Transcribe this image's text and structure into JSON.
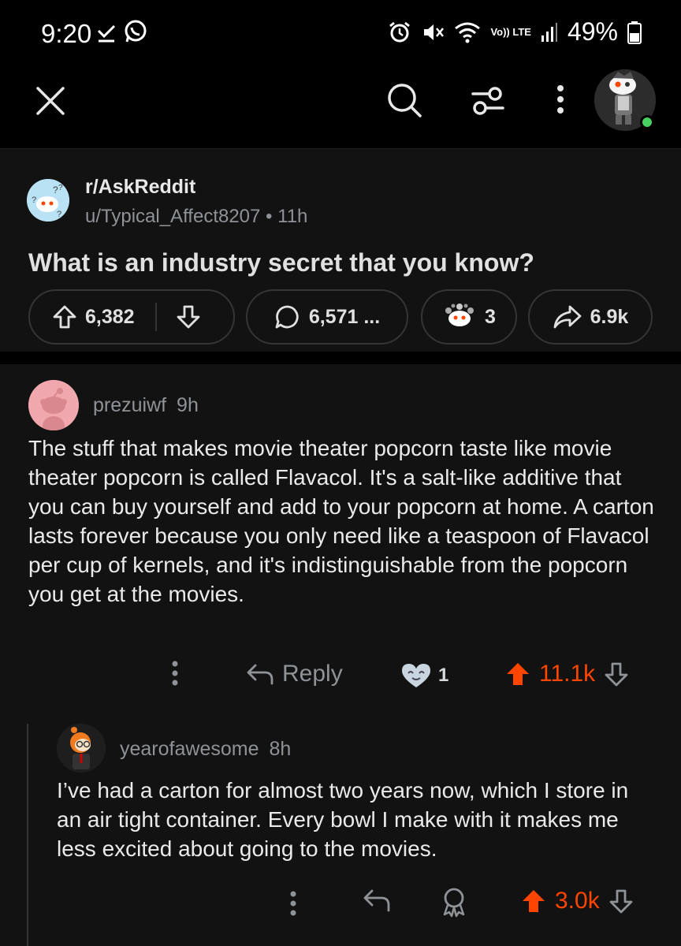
{
  "status_bar": {
    "time": "9:20",
    "battery": "49%",
    "network": "Vo)) LTE"
  },
  "nav": {
    "close_icon": "close-icon",
    "search_icon": "search-icon",
    "filter_icon": "filter-icon",
    "more_icon": "more-vertical-icon"
  },
  "post": {
    "subreddit": "r/AskReddit",
    "author": "u/Typical_Affect8207",
    "separator": "•",
    "age": "11h",
    "title": "What is an industry secret that you know?",
    "upvotes": "6,382",
    "comments": "6,571 ...",
    "awards": "3",
    "shares": "6.9k"
  },
  "comments": [
    {
      "author": "prezuiwf",
      "age": "9h",
      "body": "The stuff that makes movie theater popcorn taste like movie theater popcorn is called Flavacol. It's a salt-like additive that you can buy yourself and add to your popcorn at home. A carton lasts forever because you only need like a teaspoon of Flavacol per cup of kernels, and it's indistinguishable from the popcorn you get at the movies.",
      "reply_label": "Reply",
      "award_count": "1",
      "score": "11.1k"
    },
    {
      "author": "yearofawesome",
      "age": "8h",
      "body": "I’ve had a carton for almost two years now, which I store in an air tight container.  Every bowl I make with it makes me less excited about going to the movies.",
      "score": "3.0k"
    }
  ],
  "colors": {
    "background": "#000000",
    "card": "#121212",
    "upvote": "#ff4500",
    "muted": "#8f9296",
    "online": "#46d160"
  }
}
